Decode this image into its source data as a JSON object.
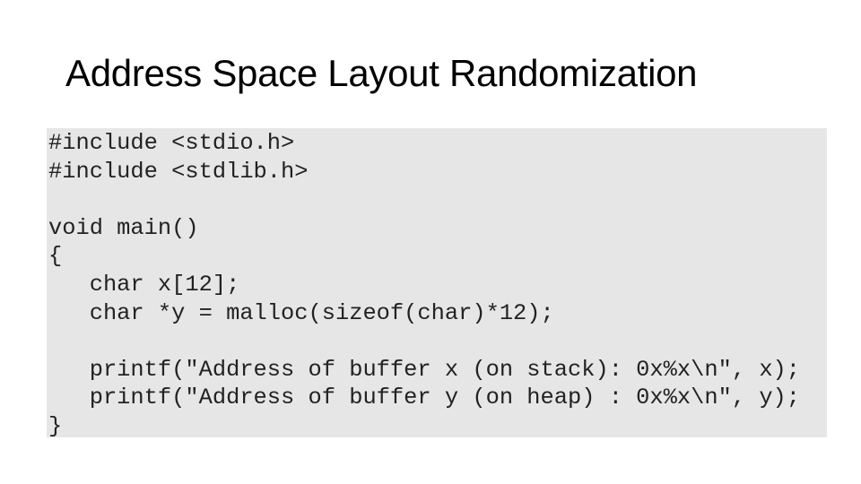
{
  "slide": {
    "title": "Address Space Layout Randomization"
  },
  "code": {
    "language": "c",
    "background_color": "#e6e6e6",
    "lines": [
      "#include <stdio.h>",
      "#include <stdlib.h>",
      "",
      "void main()",
      "{",
      "   char x[12];",
      "   char *y = malloc(sizeof(char)*12);",
      "",
      "   printf(\"Address of buffer x (on stack): 0x%x\\n\", x);",
      "   printf(\"Address of buffer y (on heap) : 0x%x\\n\", y);",
      "}"
    ]
  }
}
